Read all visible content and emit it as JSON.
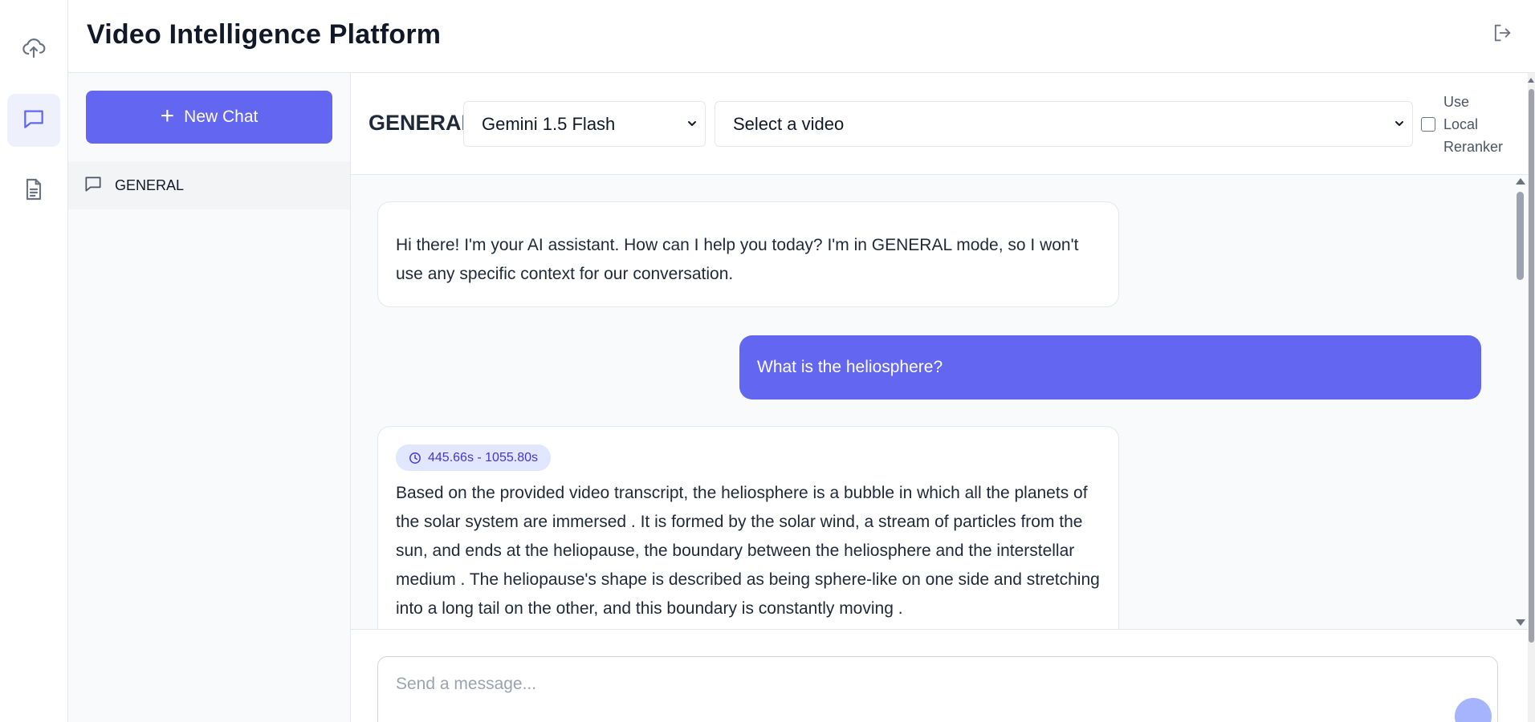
{
  "app": {
    "title": "Video Intelligence Platform"
  },
  "rail": {
    "items": [
      {
        "icon": "cloud-upload-icon",
        "active": false
      },
      {
        "icon": "chat-bubble-icon",
        "active": true
      },
      {
        "icon": "document-icon",
        "active": false
      }
    ]
  },
  "header": {
    "logout_icon": "logout-icon"
  },
  "sidebar": {
    "new_chat_label": "New Chat",
    "chats": [
      {
        "label": "GENERAL",
        "icon": "chat-bubble-icon",
        "active": true
      }
    ]
  },
  "toolbar": {
    "mode": "GENERAL",
    "model_select": {
      "value": "Gemini 1.5 Flash"
    },
    "video_select": {
      "value": "Select a video"
    },
    "reranker": {
      "label": "Use Local Reranker",
      "checked": false
    }
  },
  "messages": [
    {
      "role": "assistant",
      "text": "Hi there! I'm your AI assistant. How can I help you today? I'm in GENERAL mode, so I won't use any specific context for our conversation."
    },
    {
      "role": "user",
      "text": "What is the heliosphere?"
    },
    {
      "role": "assistant",
      "timestamp": "445.66s - 1055.80s",
      "text": "Based on the provided video transcript, the heliosphere is a bubble in which all the planets of the solar system are immersed . It is formed by the solar wind, a stream of particles from the sun, and ends at the heliopause, the boundary between the heliosphere and the interstellar medium . The heliopause's shape is described as being sphere-like on one side and stretching into a long tail on the other, and this boundary is constantly moving ."
    }
  ],
  "composer": {
    "placeholder": "Send a message..."
  },
  "colors": {
    "accent": "#6366f1",
    "accent_light": "#eef0fc",
    "badge_bg": "#e0e7ff",
    "badge_text": "#4338ca"
  }
}
